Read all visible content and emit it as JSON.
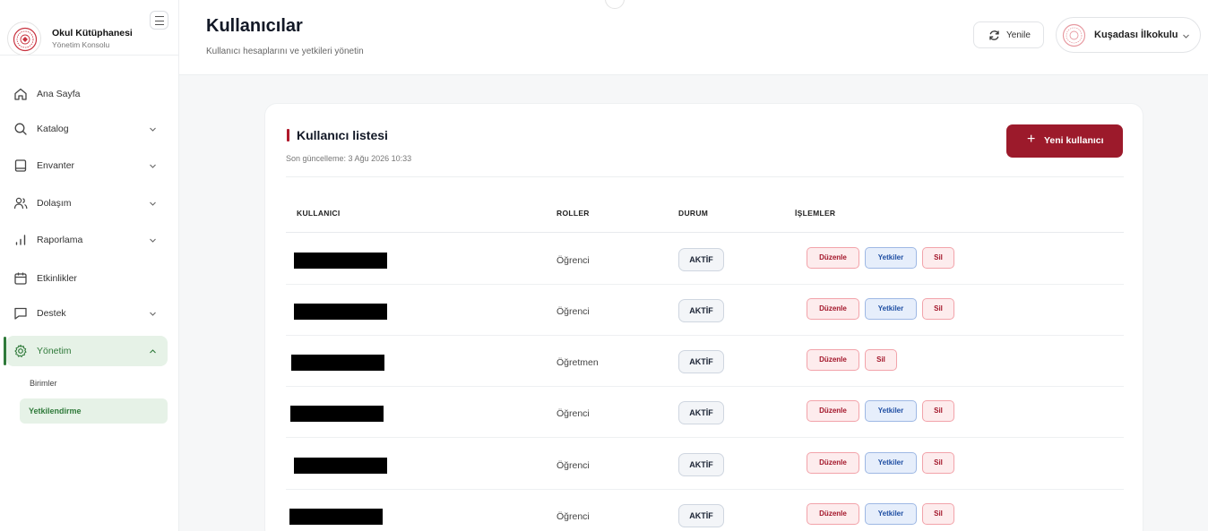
{
  "brand": {
    "title": "Okul Kütüphanesi",
    "subtitle": "Yönetim Konsolu"
  },
  "sidebar": {
    "items": [
      {
        "label": "Ana Sayfa",
        "icon": "home-icon",
        "expandable": false
      },
      {
        "label": "Katalog",
        "icon": "search-icon",
        "expandable": true
      },
      {
        "label": "Envanter",
        "icon": "inventory-icon",
        "expandable": true
      },
      {
        "label": "Dolaşım",
        "icon": "users-icon",
        "expandable": true
      },
      {
        "label": "Raporlama",
        "icon": "bar-chart-icon",
        "expandable": true
      },
      {
        "label": "Etkinlikler",
        "icon": "calendar-icon",
        "expandable": false
      },
      {
        "label": "Destek",
        "icon": "chat-icon",
        "expandable": true
      },
      {
        "label": "Yönetim",
        "icon": "gear-icon",
        "expandable": true,
        "active": true
      }
    ],
    "sub_items": [
      {
        "label": "Birimler",
        "active": false
      },
      {
        "label": "Yetkilendirme",
        "active": true
      }
    ]
  },
  "header": {
    "title": "Kullanıcılar",
    "subtitle": "Kullanıcı hesaplarını ve yetkileri yönetin",
    "refresh_label": "Yenile",
    "school_name": "Kuşadası İlkokulu"
  },
  "card": {
    "title": "Kullanıcı listesi",
    "updated": "Son güncelleme: 3 Ağu 2026 10:33",
    "new_user_label": "Yeni kullanıcı",
    "new_user_icon": "+"
  },
  "table": {
    "headers": {
      "user": "KULLANICI",
      "roles": "ROLLER",
      "status": "DURUM",
      "actions": "İŞLEMLER"
    },
    "actions": {
      "edit": "Düzenle",
      "permissions": "Yetkiler",
      "delete": "Sil"
    },
    "rows": [
      {
        "role": "Öğrenci",
        "status": "AKTİF",
        "has_permissions": true
      },
      {
        "role": "Öğrenci",
        "status": "AKTİF",
        "has_permissions": true
      },
      {
        "role": "Öğretmen",
        "status": "AKTİF",
        "has_permissions": false
      },
      {
        "role": "Öğrenci",
        "status": "AKTİF",
        "has_permissions": true
      },
      {
        "role": "Öğrenci",
        "status": "AKTİF",
        "has_permissions": true
      },
      {
        "role": "Öğrenci",
        "status": "AKTİF",
        "has_permissions": true
      }
    ]
  },
  "colors": {
    "brand_red": "#9c1a2b",
    "active_green": "#2f7a3a",
    "active_green_bg": "#e6f2e7"
  }
}
